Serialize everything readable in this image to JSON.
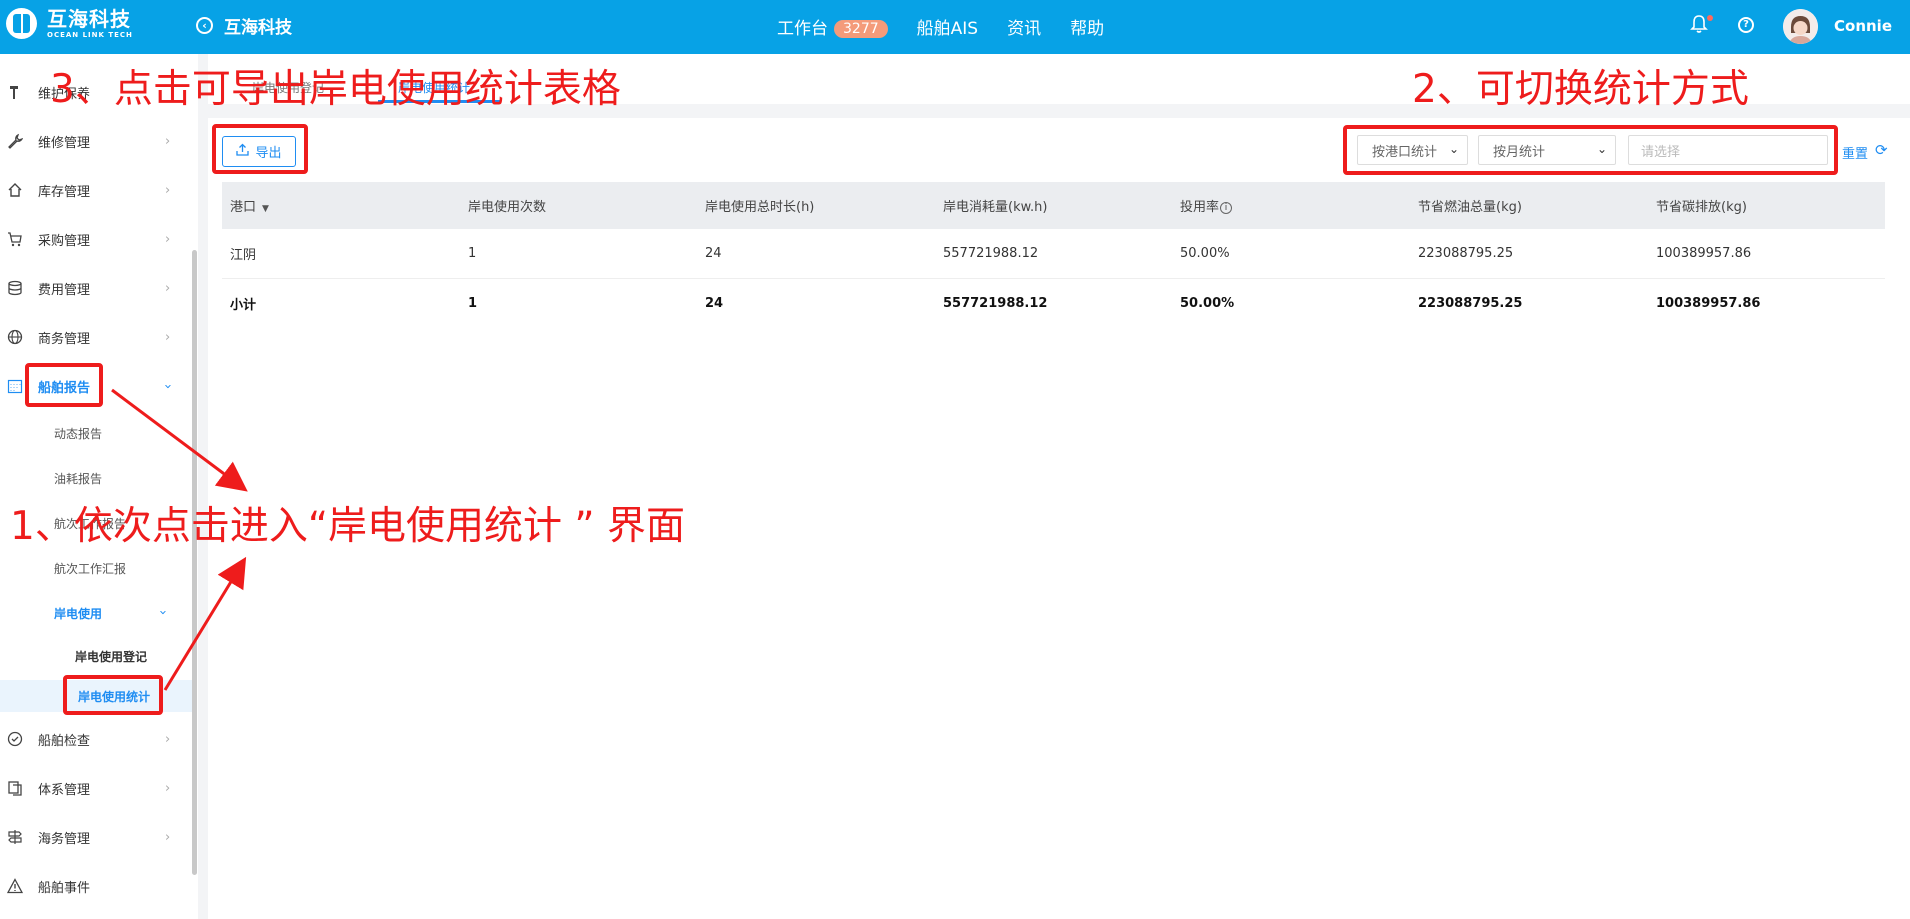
{
  "header": {
    "brand_cn": "互海科技",
    "brand_en": "OCEAN LINK TECH",
    "back_title": "互海科技",
    "nav": [
      {
        "label": "工作台",
        "badge": "3277"
      },
      {
        "label": "船舶AIS"
      },
      {
        "label": "资讯"
      },
      {
        "label": "帮助"
      }
    ],
    "user_name": "Connie"
  },
  "sidebar": {
    "items": [
      {
        "label": "维护保养",
        "icon": "hammer-icon"
      },
      {
        "label": "维修管理",
        "icon": "wrench-icon"
      },
      {
        "label": "库存管理",
        "icon": "home-icon"
      },
      {
        "label": "采购管理",
        "icon": "cart-icon"
      },
      {
        "label": "费用管理",
        "icon": "database-icon"
      },
      {
        "label": "商务管理",
        "icon": "globe-icon"
      },
      {
        "label": "船舶报告",
        "icon": "calendar-icon"
      },
      {
        "label": "船舶检查",
        "icon": "check-circle-icon"
      },
      {
        "label": "体系管理",
        "icon": "copy-icon"
      },
      {
        "label": "海务管理",
        "icon": "signpost-icon"
      },
      {
        "label": "船舶事件",
        "icon": "warning-icon"
      }
    ],
    "report_sub": [
      "动态报告",
      "油耗报告",
      "航次工作报告",
      "航次工作汇报",
      "岸电使用"
    ],
    "shore_sub": [
      "岸电使用登记",
      "岸电使用统计"
    ]
  },
  "tabs": [
    "岸电使用登记",
    "岸电使用统计"
  ],
  "toolbar": {
    "export_label": "导出",
    "group_select": "按港口统计",
    "period_select": "按月统计",
    "date_placeholder": "请选择",
    "reset_label": "重置"
  },
  "table": {
    "headers": [
      "港口",
      "岸电使用次数",
      "岸电使用总时长(h)",
      "岸电消耗量(kw.h)",
      "投用率",
      "节省燃油总量(kg)",
      "节省碳排放(kg)"
    ],
    "rows": [
      [
        "江阴",
        "1",
        "24",
        "557721988.12",
        "50.00%",
        "223088795.25",
        "100389957.86"
      ]
    ],
    "total": [
      "小计",
      "1",
      "24",
      "557721988.12",
      "50.00%",
      "223088795.25",
      "100389957.86"
    ]
  },
  "annotations": {
    "step1": "1、依次点击进入“岸电使用统计 ” 界面",
    "step2": "2、可切换统计方式",
    "step3": "3、点击可导出岸电使用统计表格"
  },
  "colors": {
    "topbar": "#07a2e6",
    "accent": "#1f8df2",
    "annotation": "#ee1c1c",
    "badge": "#f49b7a"
  }
}
